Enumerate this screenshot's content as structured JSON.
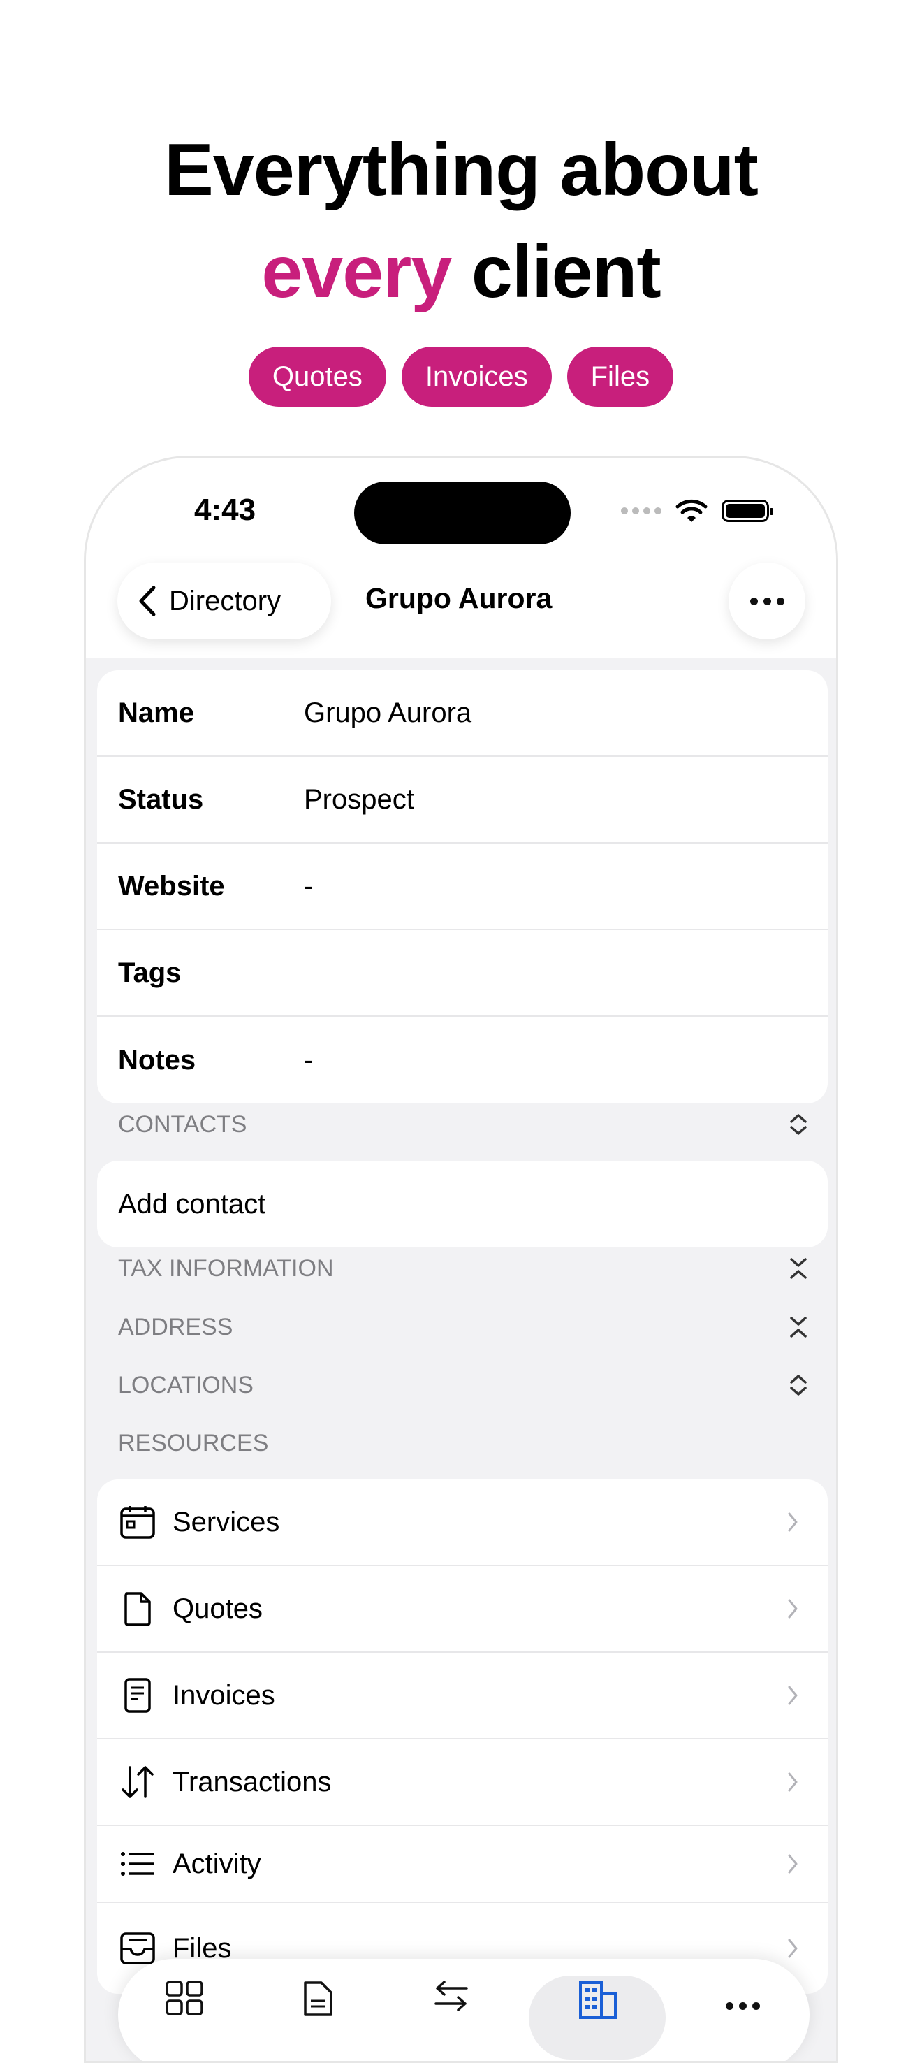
{
  "headline": {
    "line1": "Everything about",
    "accent": "every",
    "rest": " client"
  },
  "pills": [
    "Quotes",
    "Invoices",
    "Files"
  ],
  "status_bar": {
    "time": "4:43"
  },
  "nav": {
    "back_label": "Directory",
    "title": "Grupo Aurora"
  },
  "details": [
    {
      "label": "Name",
      "value": "Grupo Aurora"
    },
    {
      "label": "Status",
      "value": "Prospect"
    },
    {
      "label": "Website",
      "value": "-"
    },
    {
      "label": "Tags",
      "value": ""
    },
    {
      "label": "Notes",
      "value": "-"
    }
  ],
  "sections": {
    "contacts": "CONTACTS",
    "add_contact": "Add contact",
    "tax": "TAX INFORMATION",
    "address": "ADDRESS",
    "locations": "LOCATIONS",
    "resources": "RESOURCES"
  },
  "resources": [
    {
      "label": "Services",
      "icon": "calendar-icon"
    },
    {
      "label": "Quotes",
      "icon": "document-icon"
    },
    {
      "label": "Invoices",
      "icon": "receipt-icon"
    },
    {
      "label": "Transactions",
      "icon": "arrows-up-down-icon"
    },
    {
      "label": "Activity",
      "icon": "list-icon"
    },
    {
      "label": "Files",
      "icon": "tray-icon"
    }
  ],
  "tabbar": {
    "active": "clients",
    "tabs": [
      "dashboard-icon",
      "document-icon",
      "transfer-icon",
      "building-icon",
      "more-icon"
    ]
  },
  "colors": {
    "accent": "#c81f7c",
    "active_tab": "#1a5fd6"
  }
}
